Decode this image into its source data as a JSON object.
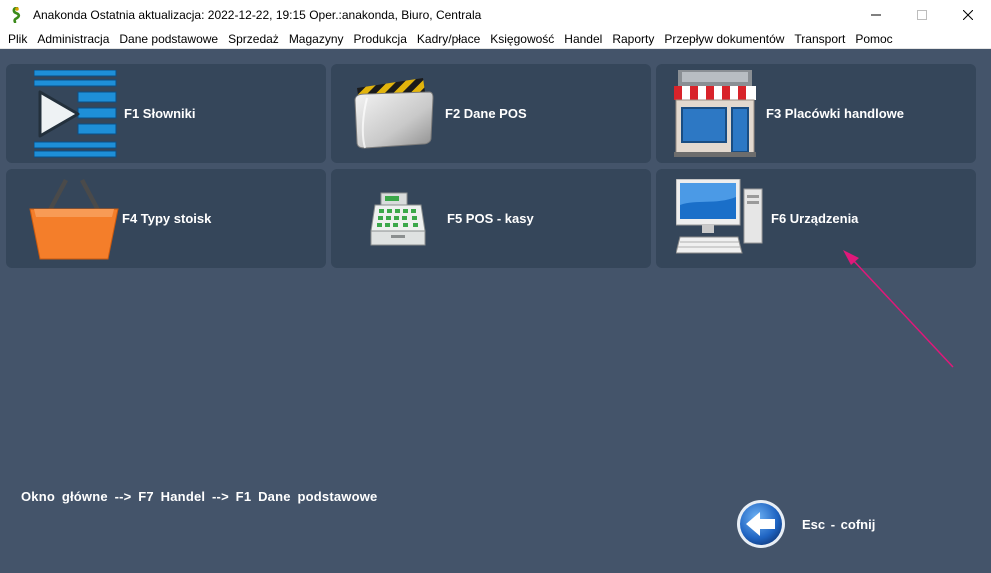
{
  "window": {
    "title": "Anakonda Ostatnia aktualizacja: 2022-12-22, 19:15 Oper.:anakonda, Biuro, Centrala",
    "minimize_glyph": "—",
    "maximize_glyph": "☐",
    "close_glyph": "✕"
  },
  "menu": [
    "Plik",
    "Administracja",
    "Dane podstawowe",
    "Sprzedaż",
    "Magazyny",
    "Produkcja",
    "Kadry/płace",
    "Księgowość",
    "Handel",
    "Raporty",
    "Przepływ dokumentów",
    "Transport",
    "Pomoc"
  ],
  "tiles": [
    {
      "label": "F1  Słowniki",
      "icon": "list-play-icon"
    },
    {
      "label": "F2  Dane POS",
      "icon": "folder-icon"
    },
    {
      "label": "F3  Placówki handlowe",
      "icon": "store-icon"
    },
    {
      "label": "F4  Typy stoisk",
      "icon": "basket-icon"
    },
    {
      "label": "F5  POS - kasy",
      "icon": "cash-register-icon"
    },
    {
      "label": "F6  Urządzenia",
      "icon": "computer-icon"
    }
  ],
  "breadcrumb": "Okno główne  -->  F7  Handel  -->  F1  Dane podstawowe",
  "esc": {
    "label": "Esc - cofnij",
    "icon": "back-arrow-icon"
  },
  "colors": {
    "background": "#44546a",
    "tile": "#35465a",
    "annotation_arrow": "#e0187a"
  }
}
